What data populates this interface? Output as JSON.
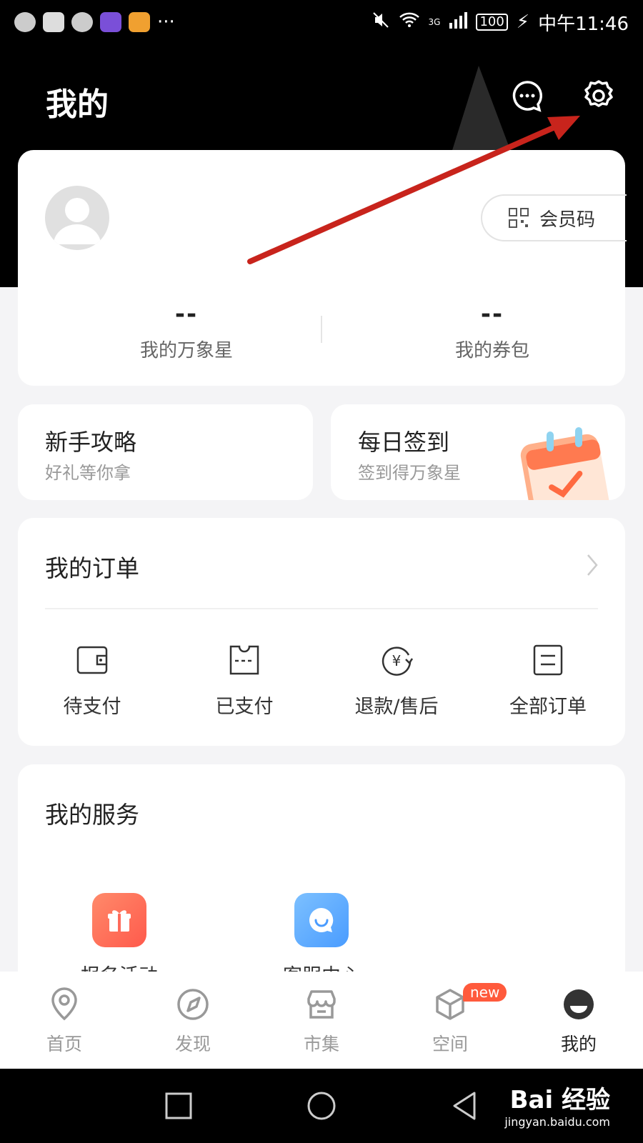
{
  "status_bar": {
    "time": "中午11:46",
    "battery": "100",
    "network": "3G"
  },
  "header": {
    "title": "我的",
    "message_icon": "chat-bubble-icon",
    "settings_icon": "gear-icon"
  },
  "profile": {
    "member_code_label": "会员码",
    "stats": [
      {
        "value": "--",
        "label": "我的万象星"
      },
      {
        "value": "--",
        "label": "我的券包"
      }
    ]
  },
  "quick_cards": [
    {
      "title": "新手攻略",
      "subtitle": "好礼等你拿"
    },
    {
      "title": "每日签到",
      "subtitle": "签到得万象星"
    }
  ],
  "orders": {
    "title": "我的订单",
    "items": [
      {
        "label": "待支付",
        "icon": "wallet-icon"
      },
      {
        "label": "已支付",
        "icon": "ticket-icon"
      },
      {
        "label": "退款/售后",
        "icon": "refund-yen-icon"
      },
      {
        "label": "全部订单",
        "icon": "list-icon"
      }
    ]
  },
  "services": {
    "title": "我的服务",
    "items": [
      {
        "label": "报名活动",
        "icon": "gift-icon",
        "color": "#ff6b5b"
      },
      {
        "label": "客服中心",
        "icon": "chat-smile-icon",
        "color": "#56aaff"
      }
    ]
  },
  "tabbar": {
    "items": [
      {
        "label": "首页",
        "icon": "location-pin-icon"
      },
      {
        "label": "发现",
        "icon": "compass-icon"
      },
      {
        "label": "市集",
        "icon": "store-icon"
      },
      {
        "label": "空间",
        "icon": "cube-icon"
      },
      {
        "label": "我的",
        "icon": "profile-face-icon"
      }
    ],
    "new_badge": "new",
    "active": "我的"
  },
  "watermark": {
    "brand": "Bai 经验",
    "url": "jingyan.baidu.com"
  },
  "colors": {
    "accent": "#ff5a3c",
    "annotation_arrow": "#c8241c"
  }
}
